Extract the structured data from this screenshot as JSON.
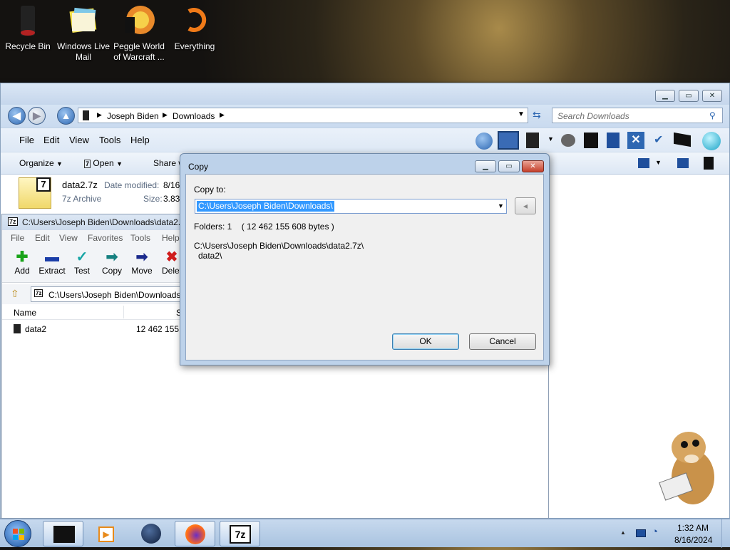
{
  "desktop_icons": [
    {
      "label": "Recycle Bin"
    },
    {
      "label": "Windows Live Mail"
    },
    {
      "label": "Peggle World of Warcraft ..."
    },
    {
      "label": "Everything"
    }
  ],
  "explorer": {
    "breadcrumb": [
      "Joseph Biden",
      "Downloads"
    ],
    "search_placeholder": "Search Downloads",
    "menu": [
      "File",
      "Edit",
      "View",
      "Tools",
      "Help"
    ],
    "commands": {
      "organize": "Organize",
      "open": "Open",
      "share": "Share w"
    },
    "details": {
      "filename": "data2.7z",
      "type": "7z Archive",
      "modified_label": "Date modified:",
      "modified_value": "8/16",
      "size_label": "Size:",
      "size_value": "3.83"
    }
  },
  "sevenzip": {
    "title": "C:\\Users\\Joseph Biden\\Downloads\\data2.",
    "menu": [
      "File",
      "Edit",
      "View",
      "Favorites",
      "Tools",
      "Help"
    ],
    "tools": [
      "Add",
      "Extract",
      "Test",
      "Copy",
      "Move",
      "Delet"
    ],
    "path": "C:\\Users\\Joseph Biden\\Downloads\\",
    "columns": {
      "name": "Name",
      "size": "S"
    },
    "rows": [
      {
        "name": "data2",
        "size": "12 462 155 6"
      }
    ]
  },
  "dialog": {
    "title": "Copy",
    "copy_to_label": "Copy to:",
    "copy_to_value": "C:\\Users\\Joseph Biden\\Downloads\\",
    "info": "Folders: 1    ( 12 462 155 608 bytes )",
    "source_line1": "C:\\Users\\Joseph Biden\\Downloads\\data2.7z\\",
    "source_line2": "data2\\",
    "ok": "OK",
    "cancel": "Cancel"
  },
  "tray": {
    "time": "1:32 AM",
    "date": "8/16/2024"
  },
  "colors": {
    "selection": "#3399ff",
    "aero": "#c4d7ed"
  }
}
